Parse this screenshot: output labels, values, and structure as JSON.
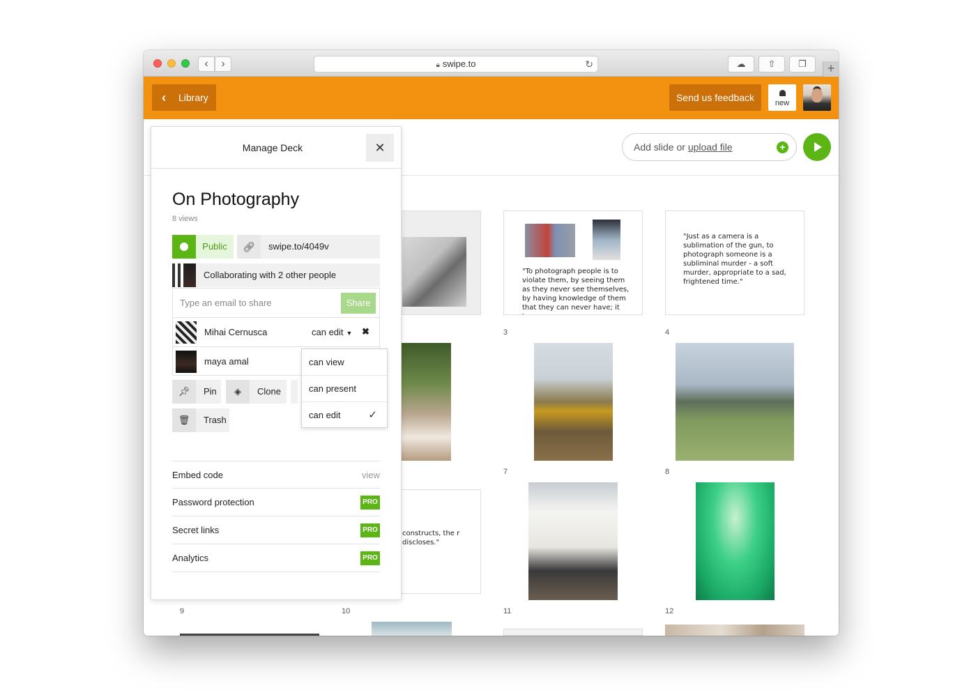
{
  "browser": {
    "url": "swipe.to",
    "icons": [
      "lock-icon",
      "reload-icon",
      "cloud-icon",
      "share-icon",
      "tabs-icon",
      "new-tab-icon"
    ]
  },
  "header": {
    "library_label": "Library",
    "feedback_label": "Send us feedback",
    "notification_label": "new",
    "accent_color": "#f39110"
  },
  "toolbar": {
    "add_slide_text": "Add slide or ",
    "upload_link": "upload file"
  },
  "panel": {
    "title": "Manage Deck",
    "deck_title": "On Photography",
    "views": "8 views",
    "visibility": "Public",
    "share_url": "swipe.to/4049v",
    "collaborators_summary": "Collaborating with 2 other people",
    "email_placeholder": "Type an email to share",
    "share_button": "Share",
    "users": [
      {
        "name": "Mihai Cernusca",
        "permission": "can edit"
      },
      {
        "name": "maya amal"
      }
    ],
    "actions": {
      "pin": "Pin",
      "clone": "Clone",
      "trash": "Trash"
    },
    "settings": {
      "embed": {
        "label": "Embed code",
        "value": "view"
      },
      "password": {
        "label": "Password protection",
        "badge": "PRO"
      },
      "secret_links": {
        "label": "Secret links",
        "badge": "PRO"
      },
      "analytics": {
        "label": "Analytics",
        "badge": "PRO"
      }
    },
    "permission_options": [
      "can view",
      "can present",
      "can edit"
    ],
    "selected_permission": "can edit"
  },
  "slides": {
    "numbers": [
      "3",
      "4",
      "7",
      "8",
      "9",
      "10",
      "11",
      "12"
    ],
    "quote3": "\"To photograph people is to violate them, by seeing them as they never see themselves, by having knowledge of them that they can never have; it turns",
    "quote4": "\"Just as a camera is a sublimation of the gun, to photograph someone is a subliminal murder - a soft murder, appropriate to a sad, frightened time.\"",
    "quote6_partial": "constructs, the r discloses.\""
  },
  "colors": {
    "green": "#5bb514",
    "orange": "#f39110",
    "dark_orange": "#cc700a"
  }
}
